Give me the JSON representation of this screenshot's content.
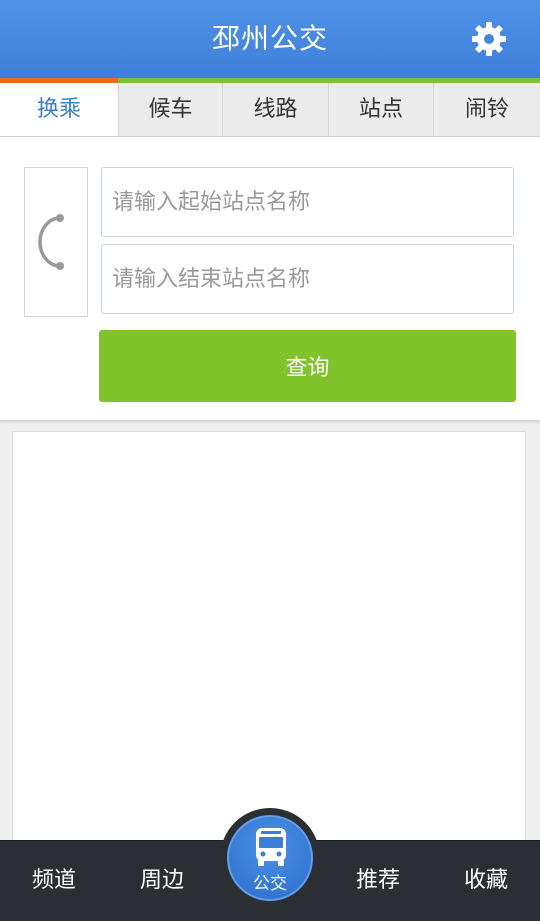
{
  "header": {
    "title": "邳州公交",
    "settings_icon": "gear-icon"
  },
  "tabs": [
    {
      "label": "换乘",
      "active": true
    },
    {
      "label": "候车",
      "active": false
    },
    {
      "label": "线路",
      "active": false
    },
    {
      "label": "站点",
      "active": false
    },
    {
      "label": "闹铃",
      "active": false
    }
  ],
  "search": {
    "swap_icon": "swap-arc-icon",
    "start_placeholder": "请输入起始站点名称",
    "start_value": "",
    "end_placeholder": "请输入结束站点名称",
    "end_value": "",
    "query_label": "查询"
  },
  "bottom_nav": {
    "items": [
      "频道",
      "周边",
      "公交",
      "推荐",
      "收藏"
    ],
    "center_icon": "bus-icon",
    "active": "公交"
  },
  "colors": {
    "header": "#4589e0",
    "accent_orange": "#e96d1e",
    "accent_green": "#7ac142",
    "active_tab_text": "#3b7fc8",
    "query_button": "#80c32b",
    "bottom_bar": "#2b2f33"
  }
}
